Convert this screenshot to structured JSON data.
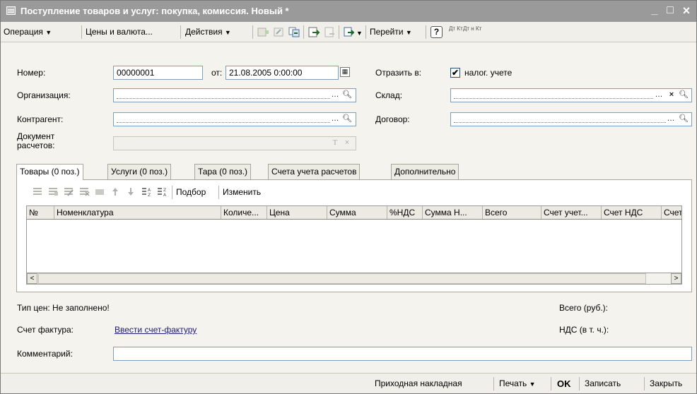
{
  "window": {
    "title": "Поступление товаров и услуг: покупка, комиссия. Новый *",
    "controls": [
      "_",
      "□",
      "×"
    ]
  },
  "toolbar": {
    "operation": "Операция",
    "prices": "Цены и валюта...",
    "actions": "Действия",
    "goto": "Перейти",
    "help": "?",
    "dt_kt": "Дт Кт",
    "dt_kt_n": "Дт н Кт"
  },
  "form": {
    "number_label": "Номер:",
    "number_value": "00000001",
    "date_label": "от:",
    "date_value": "21.08.2005 0:00:00",
    "reflect_label": "Отразить в:",
    "tax_checkbox_label": "налог. учете",
    "tax_checked": true,
    "org_label": "Организация:",
    "warehouse_label": "Склад:",
    "counterparty_label": "Контрагент:",
    "contract_label": "Договор:",
    "settlement_label_line1": "Документ",
    "settlement_label_line2": "расчетов:"
  },
  "tabs": [
    {
      "label": "Товары (0 поз.)",
      "active": true
    },
    {
      "label": "Услуги (0 поз.)",
      "active": false
    },
    {
      "label": "Тара (0 поз.)",
      "active": false
    },
    {
      "label": "Счета учета расчетов",
      "active": false
    },
    {
      "label": "Дополнительно",
      "active": false
    }
  ],
  "table_toolbar": {
    "selection": "Подбор",
    "change": "Изменить"
  },
  "table": {
    "columns": [
      "№",
      "Номенклатура",
      "Количе...",
      "Цена",
      "Сумма",
      "%НДС",
      "Сумма Н...",
      "Всего",
      "Счет учет...",
      "Счет НДС",
      "Счет"
    ],
    "rows": []
  },
  "footer": {
    "price_type": "Тип цен: Не заполнено!",
    "total_label": "Всего (руб.):",
    "invoice_label": "Счет фактура:",
    "invoice_link": "Ввести счет-фактуру",
    "vat_label": "НДС (в т. ч.):",
    "comment_label": "Комментарий:"
  },
  "bottom_buttons": {
    "receipt": "Приходная накладная",
    "print": "Печать",
    "ok": "OK",
    "save": "Записать",
    "close": "Закрыть"
  },
  "colors": {
    "titlebar": "#9a9a9a",
    "window_bg": "#f4f3ee",
    "field_border": "#7f9db9"
  }
}
